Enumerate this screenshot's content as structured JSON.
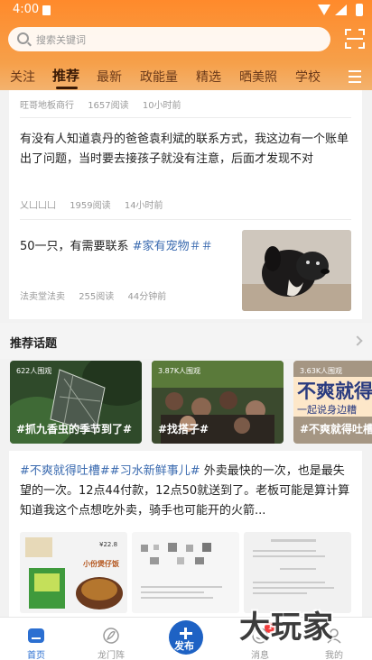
{
  "status_bar": {
    "time": "4:00"
  },
  "search": {
    "placeholder": "搜索关键词"
  },
  "tabs": [
    "关注",
    "推荐",
    "最新",
    "政能量",
    "精选",
    "晒美照",
    "学校"
  ],
  "active_tab": "推荐",
  "feed": {
    "post0_meta": {
      "author": "旺哥地板商行",
      "reads": "1657阅读",
      "time": "10小时前"
    },
    "post1": {
      "text": "有没有人知道袁丹的爸爸袁利斌的联系方式，我这边有一个账单出了问题，当时要去接孩子就没有注意，后面才发现不对",
      "author": "乂凵凵凵",
      "reads": "1959阅读",
      "time": "14小时前"
    },
    "post2": {
      "text": "50一只，有需要联系 ",
      "hashtag": "#家有宠物＃＃",
      "author": "法卖堂法卖",
      "reads": "255阅读",
      "time": "44分钟前"
    }
  },
  "topics": {
    "title": "推荐话题",
    "items": [
      {
        "views": "622人围观",
        "name": "#抓九香虫的季节到了#"
      },
      {
        "views": "3.87K人围观",
        "name": "#找搭子#"
      },
      {
        "views": "3.63K人围观",
        "name": "#不爽就得吐槽#",
        "overlay_big": "不爽就得",
        "overlay_small": "一起说身边糟"
      }
    ]
  },
  "post3": {
    "tag1": "#不爽就得吐槽#",
    "tag2": "#习水新鲜事儿#",
    "text": " 外卖最快的一次，也是最失望的一次。12点44付款，12点50就送到了。老板可能是算计算知道我这个点想吃外卖，骑手也可能开的火箭...",
    "thumb1_price": "¥22.8",
    "thumb1_label": "小份煲仔饭"
  },
  "tabbar": {
    "home": "首页",
    "longmen": "龙门阵",
    "publish": "发布",
    "messages": "消息",
    "me": "我的",
    "message_badge": "1"
  },
  "watermark": "大玩家"
}
